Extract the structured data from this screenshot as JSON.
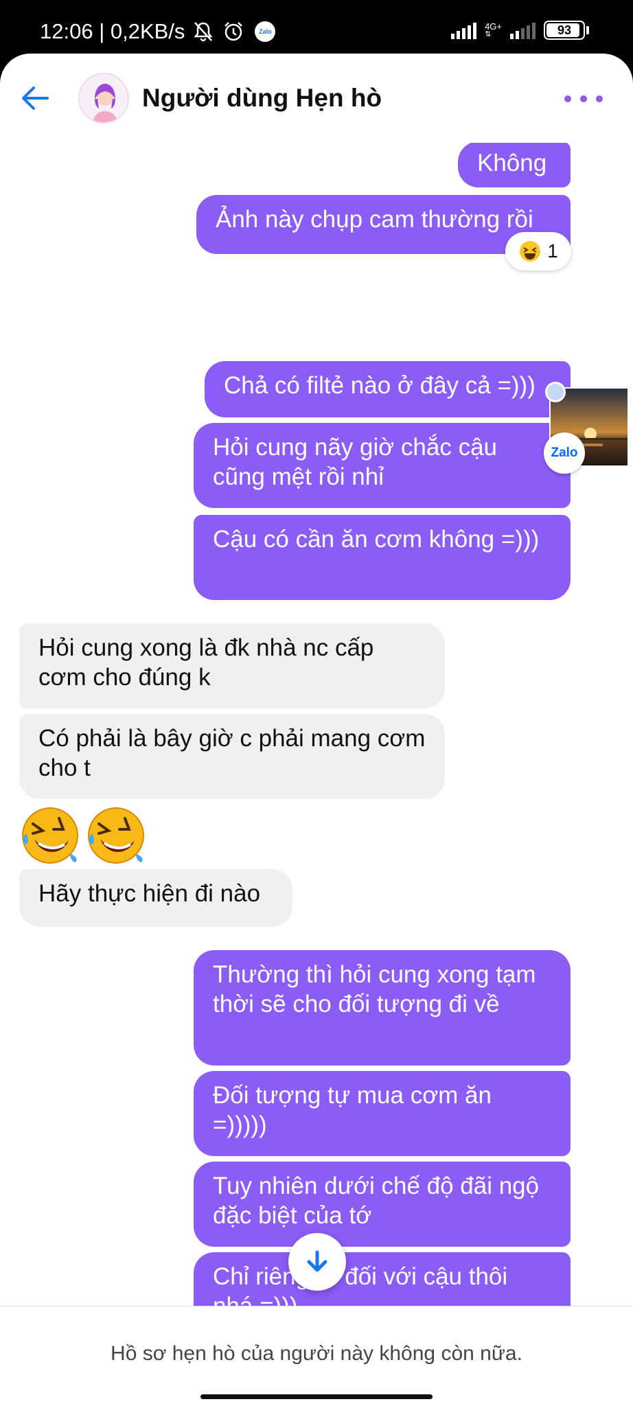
{
  "status_bar": {
    "time_speed": "12:06 | 0,2KB/s",
    "network_label": "4G+",
    "battery": "93",
    "battery_level": 0.93
  },
  "header": {
    "title": "Người dùng Hẹn hò"
  },
  "messages": [
    {
      "id": "m1",
      "side": "sent",
      "text": "Không"
    },
    {
      "id": "m2",
      "side": "sent",
      "text": "Ảnh này chụp cam thường rồi"
    },
    {
      "id": "m3",
      "side": "sent",
      "text": "Chả có filtẻ nào ở đây cả =)))"
    },
    {
      "id": "m4",
      "side": "sent",
      "text": "Hỏi cung nãy giờ chắc cậu cũng mệt rồi nhỉ"
    },
    {
      "id": "m5",
      "side": "sent",
      "text": "Cậu có cần ăn cơm không =)))"
    },
    {
      "id": "m6",
      "side": "recv",
      "text": "Hỏi cung xong là đk nhà nc cấp cơm cho đúng k"
    },
    {
      "id": "m7",
      "side": "recv",
      "text": "Có phải là bây giờ c phải mang cơm cho t"
    },
    {
      "id": "m8",
      "side": "recv",
      "text": "Hãy thực hiện đi nào"
    },
    {
      "id": "m9",
      "side": "sent",
      "text": "Thường thì hỏi cung xong tạm thời sẽ cho đối tượng đi về"
    },
    {
      "id": "m10",
      "side": "sent",
      "text": "Đối tượng tự mua cơm ăn =)))))"
    },
    {
      "id": "m11",
      "side": "sent",
      "text": "Tuy nhiên dưới chế độ đãi ngộ đặc biệt của tớ"
    },
    {
      "id": "m12",
      "side": "sent",
      "text": "Chỉ riêng tớ đối với cậu thôi nhá =)))"
    }
  ],
  "reaction": {
    "icon": "laughing-emoji",
    "count": "1"
  },
  "emoji_message": {
    "icons": [
      "rolling-laughing-emoji",
      "rolling-laughing-emoji"
    ]
  },
  "zalo_bubble": {
    "label": "Zalo"
  },
  "footer": {
    "notice": "Hồ sơ hẹn hò của người này không còn nữa."
  },
  "colors": {
    "sent_bubble": "#8b5cf6",
    "recv_bubble": "#f0f0f2",
    "accent_back": "#1877f2"
  }
}
